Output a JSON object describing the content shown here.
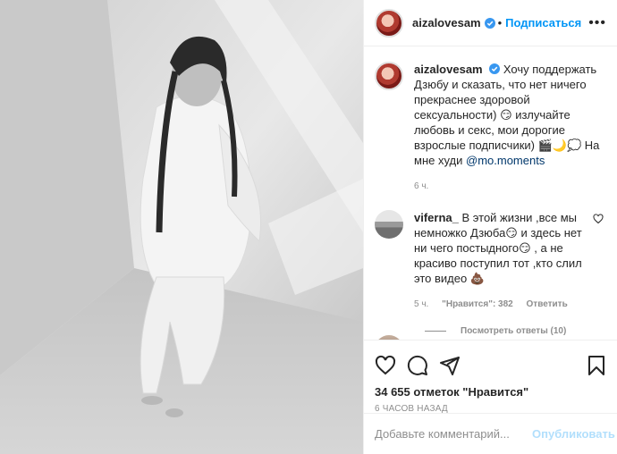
{
  "post": {
    "username": "aizalovesam",
    "follow_label": "Подписаться",
    "more_label": "•••",
    "caption": {
      "username": "aizalovesam",
      "text": "Хочу поддержать Дзюбу и сказать, что нет ничего прекраснее здоровой сексуальности) 😏 излучайте любовь и секс, мои дорогие взрослые подписчики) 🎬🌙💭 На мне худи ",
      "mention": "@mo.moments",
      "time": "6 ч."
    },
    "comment": {
      "username": "viferna_",
      "text": "В этой жизни ,все мы немножко Дзюба😏 и здесь нет ни чего постыдного😏 , а не красиво поступил тот ,кто слил это видео 💩",
      "time": "5 ч.",
      "likes": "\"Нравится\": 382",
      "reply": "Ответить",
      "view_replies": "Посмотреть ответы (10)"
    },
    "likes_count": "34 655 отметок \"Нравится\"",
    "posted_ago": "6 ЧАСОВ НАЗАД",
    "add_comment_placeholder": "Добавьте комментарий...",
    "publish_label": "Опубликовать"
  },
  "icons": {
    "like": "heart-icon",
    "comment": "comment-icon",
    "share": "share-icon",
    "save": "bookmark-icon",
    "verified": "verified-badge-icon"
  },
  "colors": {
    "accent": "#0095f6",
    "muted": "#8e8e8e",
    "border": "#efefef"
  }
}
